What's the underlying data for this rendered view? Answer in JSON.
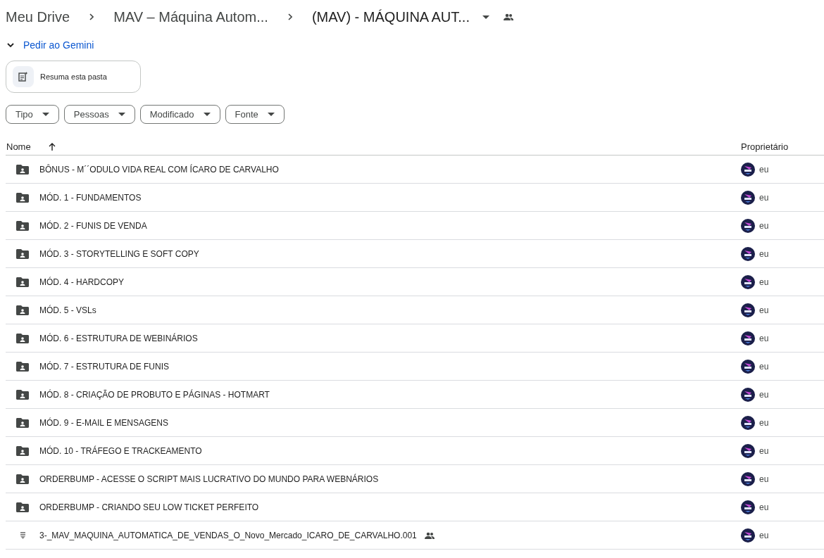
{
  "breadcrumb": [
    "Meu Drive",
    "MAV – Máquina Autom...",
    "(MAV) - MÁQUINA AUT..."
  ],
  "gemini": {
    "label": "Pedir ao Gemini",
    "expanded": true
  },
  "suggestion": "Resuma esta pasta",
  "filters": [
    "Tipo",
    "Pessoas",
    "Modificado",
    "Fonte"
  ],
  "table": {
    "columns": [
      {
        "label": "Nome",
        "sorted": true
      },
      {
        "label": "Proprietário",
        "sorted": false
      }
    ],
    "rows": [
      {
        "kind": "folder",
        "name": "BÔNUS - M´´ODULO VIDA REAL COM ÍCARO DE CARVALHO",
        "shared": false,
        "owner": "eu"
      },
      {
        "kind": "folder",
        "name": "MÓD. 1 - FUNDAMENTOS",
        "shared": false,
        "owner": "eu"
      },
      {
        "kind": "folder",
        "name": "MÓD. 2 - FUNIS DE VENDA",
        "shared": false,
        "owner": "eu"
      },
      {
        "kind": "folder",
        "name": "MÓD. 3 - STORYTELLING E SOFT COPY",
        "shared": false,
        "owner": "eu"
      },
      {
        "kind": "folder",
        "name": "MÓD. 4 - HARDCOPY",
        "shared": false,
        "owner": "eu"
      },
      {
        "kind": "folder",
        "name": "MÓD. 5 - VSLs",
        "shared": false,
        "owner": "eu"
      },
      {
        "kind": "folder",
        "name": "MÓD. 6 - ESTRUTURA DE WEBINÁRIOS",
        "shared": false,
        "owner": "eu"
      },
      {
        "kind": "folder",
        "name": "MÓD. 7 - ESTRUTURA DE FUNIS",
        "shared": false,
        "owner": "eu"
      },
      {
        "kind": "folder",
        "name": "MÓD. 8 - CRIAÇÃO DE PROBUTO E PÁGINAS - HOTMART",
        "shared": false,
        "owner": "eu"
      },
      {
        "kind": "folder",
        "name": "MÓD. 9 - E-MAIL E MENSAGENS",
        "shared": false,
        "owner": "eu"
      },
      {
        "kind": "folder",
        "name": "MÓD. 10 - TRÁFEGO E TRACKEAMENTO",
        "shared": false,
        "owner": "eu"
      },
      {
        "kind": "folder",
        "name": "ORDERBUMP - ACESSE O SCRIPT MAIS LUCRATIVO DO MUNDO PARA WEBNÁRIOS",
        "shared": false,
        "owner": "eu"
      },
      {
        "kind": "folder",
        "name": "ORDERBUMP - CRIANDO SEU LOW TICKET PERFEITO",
        "shared": false,
        "owner": "eu"
      },
      {
        "kind": "file",
        "name": "3-_MAV_MAQUINA_AUTOMATICA_DE_VENDAS_O_Novo_Mercado_ICARO_DE_CARVALHO.001",
        "shared": true,
        "owner": "eu"
      }
    ]
  }
}
